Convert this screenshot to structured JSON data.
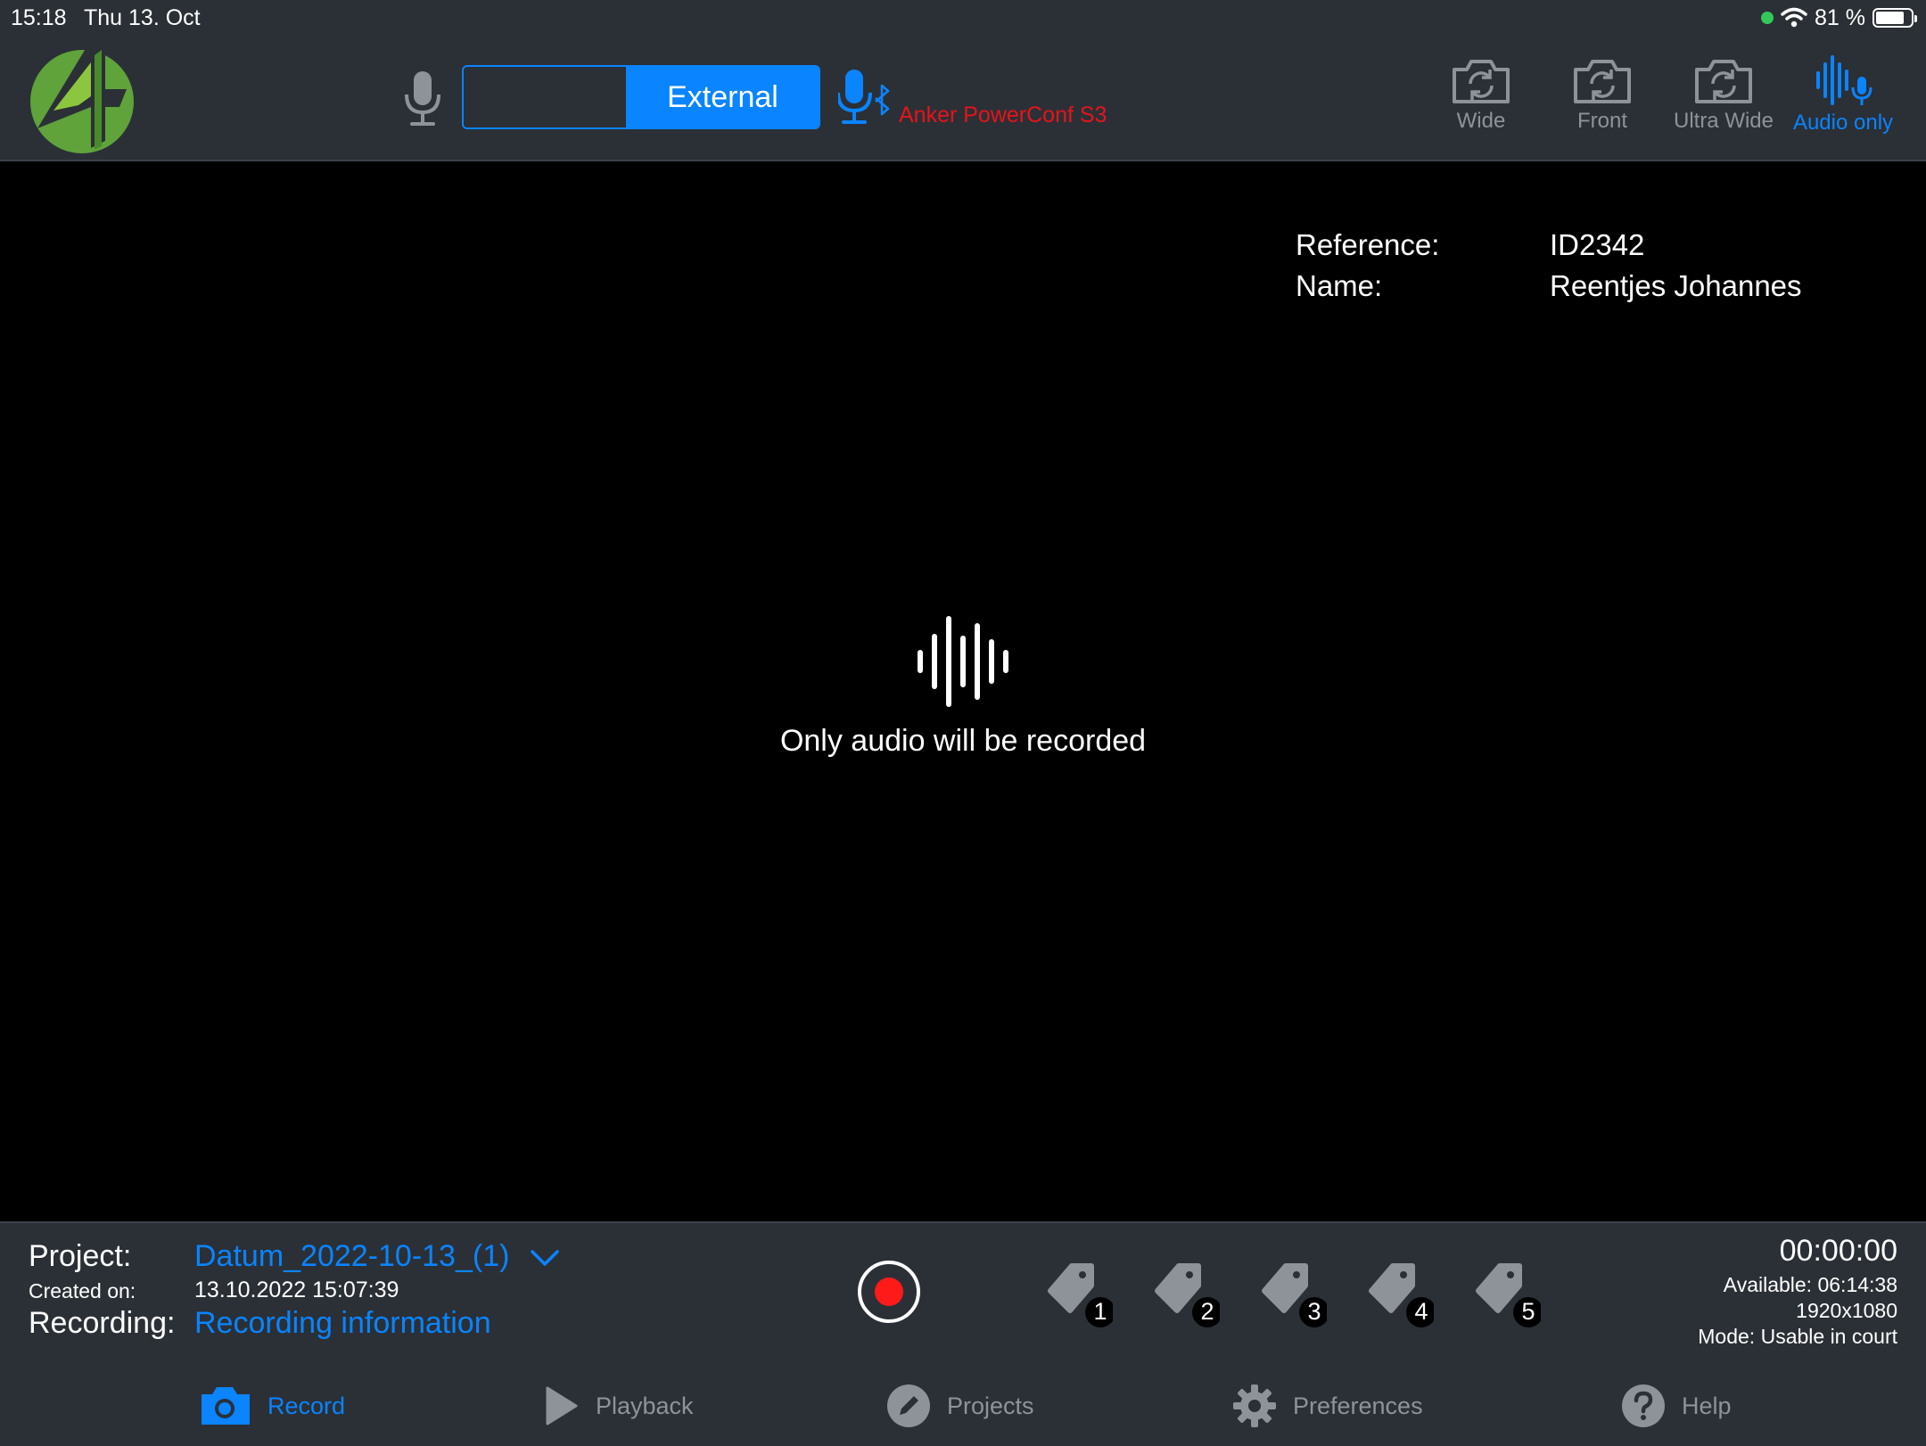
{
  "status": {
    "time": "15:18",
    "date": "Thu 13. Oct",
    "battery": "81 %",
    "battery_level": 0.81
  },
  "toolbar": {
    "mic_source_selected": "External",
    "external_device": "Anker PowerConf S3",
    "cameras": [
      {
        "label": "Wide",
        "icon": "camera-rotate-icon",
        "active": false
      },
      {
        "label": "Front",
        "icon": "camera-rotate-icon",
        "active": false
      },
      {
        "label": "Ultra Wide",
        "icon": "camera-rotate-icon",
        "active": false
      },
      {
        "label": "Audio only",
        "icon": "audio-wave-mic-icon",
        "active": true
      }
    ]
  },
  "overlay": {
    "reference_label": "Reference:",
    "reference_value": "ID2342",
    "name_label": "Name:",
    "name_value": "Reentjes Johannes",
    "message": "Only audio will be recorded"
  },
  "project": {
    "project_label": "Project:",
    "project_value": "Datum_2022-10-13_(1)",
    "created_label": "Created on:",
    "created_value": "13.10.2022 15:07:39",
    "recording_label": "Recording:",
    "recording_value": "Recording information"
  },
  "tags": [
    "1",
    "2",
    "3",
    "4",
    "5"
  ],
  "recording_info": {
    "timer": "00:00:00",
    "available": "Available: 06:14:38",
    "resolution": "1920x1080",
    "mode": "Mode: Usable in court"
  },
  "tabs": [
    {
      "label": "Record",
      "icon": "camera-icon",
      "active": true
    },
    {
      "label": "Playback",
      "icon": "play-icon",
      "active": false
    },
    {
      "label": "Projects",
      "icon": "pencil-icon",
      "active": false
    },
    {
      "label": "Preferences",
      "icon": "gear-icon",
      "active": false
    },
    {
      "label": "Help",
      "icon": "help-icon",
      "active": false
    }
  ],
  "colors": {
    "accent": "#0a84ff",
    "toolbar_bg": "#2b3036",
    "inactive": "#8e939a",
    "device_label": "#e6141a",
    "record_red": "#ff1a1a",
    "logo_green": "#5fa33a"
  }
}
